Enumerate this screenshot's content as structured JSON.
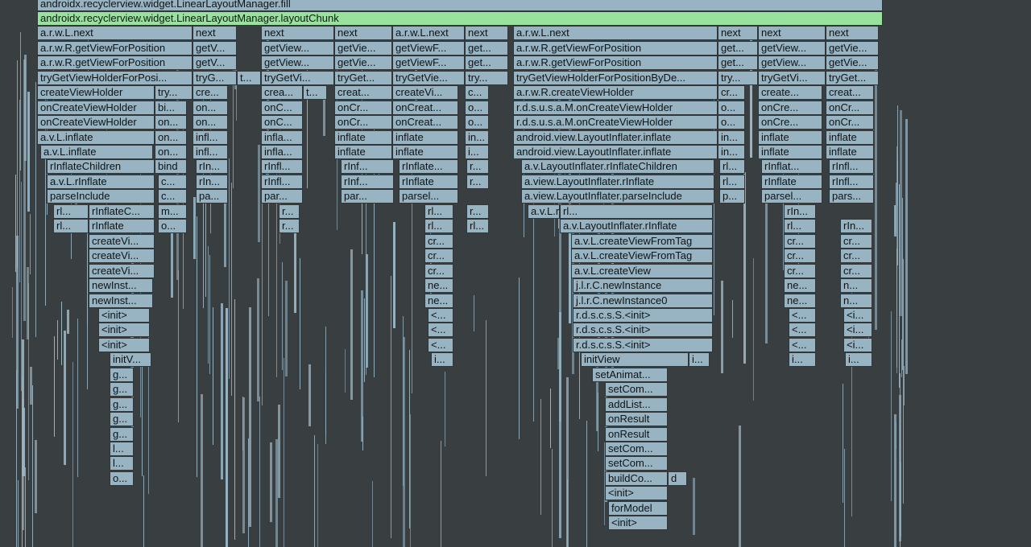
{
  "colors": {
    "background": "#393e41",
    "frame": "#98b3c2",
    "frame_highlight": "#98e29e",
    "frame_border": "#313639"
  },
  "rows": [
    [
      "androidx.recyclerview.widget.LinearLayoutManager.fill"
    ],
    [
      "androidx.recyclerview.widget.LinearLayoutManager.layoutChunk"
    ],
    [
      "a.r.w.L.next",
      "next",
      "next",
      "next",
      "a.r.w.L.next",
      "next",
      "a.r.w.L.next",
      "next",
      "next",
      "next"
    ],
    [
      "a.r.w.R.getViewForPosition",
      "getV...",
      "getView...",
      "getVie...",
      "getViewF...",
      "get...",
      "a.r.w.R.getViewForPosition",
      "get...",
      "getView...",
      "getVie..."
    ],
    [
      "a.r.w.R.getViewForPosition",
      "getV...",
      "getView...",
      "getVie...",
      "getViewF...",
      "get...",
      "a.r.w.R.getViewForPosition",
      "get...",
      "getView...",
      "getVie..."
    ],
    [
      "tryGetViewHolderForPosi...",
      "tryG...",
      "t...",
      "tryGetVi...",
      "tryGet...",
      "tryGetVie...",
      "try...",
      "tryGetViewHolderForPositionByDe...",
      "try...",
      "tryGetVi...",
      "tryGet..."
    ],
    [
      "createViewHolder",
      "try...",
      "cre...",
      "crea...",
      "t...",
      "creat...",
      "createVi...",
      "c...",
      "a.r.w.R.createViewHolder",
      "cr...",
      "create...",
      "creat..."
    ],
    [
      "onCreateViewHolder",
      "bi...",
      "on...",
      "onC...",
      "onCr...",
      "onCreat...",
      "o...",
      "r.d.s.u.s.a.M.onCreateViewHolder",
      "o...",
      "onCre...",
      "onCr..."
    ],
    [
      "onCreateViewHolder",
      "on...",
      "on...",
      "onC...",
      "onCr...",
      "onCreat...",
      "o...",
      "r.d.s.u.s.a.M.onCreateViewHolder",
      "o...",
      "onCre...",
      "onCr..."
    ],
    [
      "a.v.L.inflate",
      "on...",
      "infl...",
      "infla...",
      "inflate",
      "inflate",
      "in...",
      "android.view.LayoutInflater.inflate",
      "in...",
      "inflate",
      "inflate"
    ],
    [
      "a.v.L.inflate",
      "on...",
      "infl...",
      "infla...",
      "inflate",
      "inflate",
      "i...",
      "android.view.LayoutInflater.inflate",
      "in...",
      "inflate",
      "inflate"
    ],
    [
      "rInflateChildren",
      "bind",
      "rIn...",
      "rInfl...",
      "rInf...",
      "rInflate...",
      "r...",
      "a.v.LayoutInflater.rInflateChildren",
      "rl...",
      "rInflat...",
      "rInfl..."
    ],
    [
      "a.v.L.rInflate",
      "c...",
      "rIn...",
      "rInfl...",
      "rInf...",
      "rInflate",
      "r...",
      "a.view.LayoutInflater.rInflate",
      "rl...",
      "rInflate",
      "rInfl..."
    ],
    [
      "parseInclude",
      "c...",
      "pa...",
      "par...",
      "par...",
      "parsel...",
      "a.view.LayoutInflater.parseInclude",
      "p...",
      "parsel...",
      "pars..."
    ],
    [
      "rl...",
      "rInflateC...",
      "m...",
      "r...",
      "rl...",
      "r...",
      "a.v.L.rInflateChildren",
      "rl...",
      "rIn..."
    ],
    [
      "rl...",
      "rInflate",
      "o...",
      "r...",
      "rl...",
      "rl...",
      "a.v.LayoutInflater.rInflate",
      "rl...",
      "rIn..."
    ],
    [
      "createVi...",
      "cr...",
      "a.v.L.createViewFromTag",
      "cr...",
      "cr..."
    ],
    [
      "createVi...",
      "cr...",
      "a.v.L.createViewFromTag",
      "cr...",
      "cr..."
    ],
    [
      "createVi...",
      "cr...",
      "a.v.L.createView",
      "cr...",
      "cr..."
    ],
    [
      "newInst...",
      "ne...",
      "j.l.r.C.newInstance",
      "ne...",
      "n..."
    ],
    [
      "newInst...",
      "ne...",
      "j.l.r.C.newInstance0",
      "ne...",
      "n..."
    ],
    [
      "<init>",
      "<...",
      "r.d.s.c.s.S.<init>",
      "<...",
      "<i..."
    ],
    [
      "<init>",
      "<...",
      "r.d.s.c.s.S.<init>",
      "<...",
      "<i..."
    ],
    [
      "<init>",
      "<...",
      "r.d.s.c.s.S.<init>",
      "<...",
      "<i..."
    ],
    [
      "initV...",
      "i...",
      "initView",
      "i...",
      "i...",
      "i..."
    ],
    [
      "g...",
      "setAnimat..."
    ],
    [
      "g...",
      "setCom..."
    ],
    [
      "g...",
      "addList..."
    ],
    [
      "g...",
      "onResult"
    ],
    [
      "g...",
      "onResult"
    ],
    [
      "l...",
      "setCom..."
    ],
    [
      "l...",
      "setCom..."
    ],
    [
      "o...",
      "buildCo...",
      "d"
    ],
    [
      "<init>"
    ],
    [
      "forModel"
    ],
    [
      "<init>"
    ]
  ]
}
